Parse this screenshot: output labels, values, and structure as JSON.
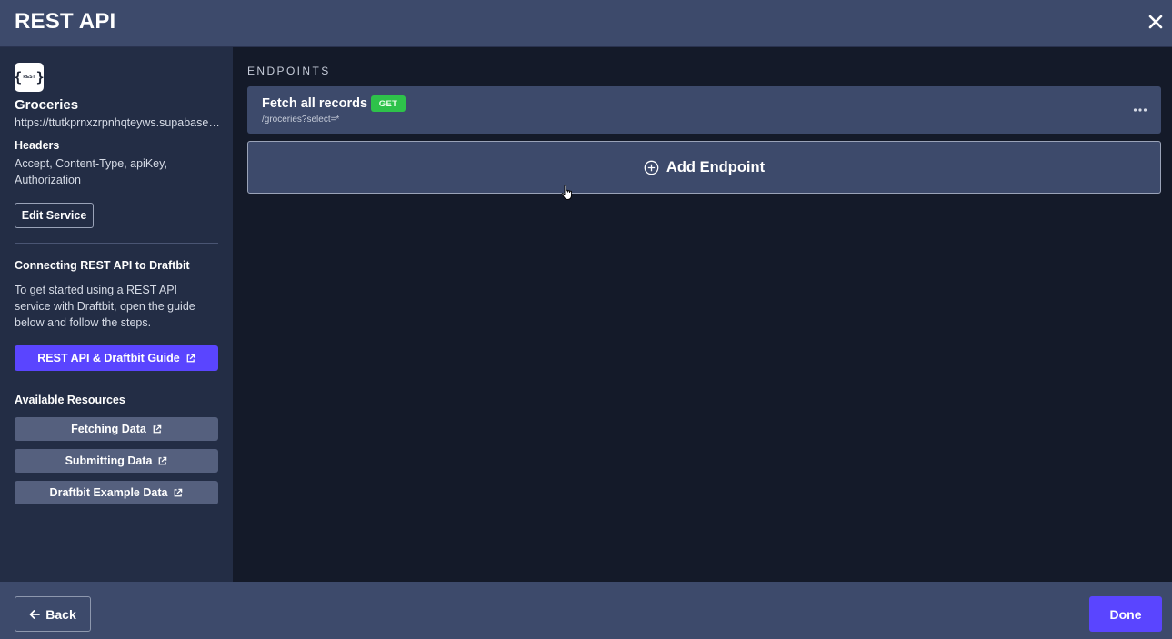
{
  "header": {
    "title": "REST API"
  },
  "sidebar": {
    "service_name": "Groceries",
    "service_url": "https://ttutkprnxzrpnhqteyws.supabase.co/rest/v1",
    "logo_text": "REST",
    "headers_title": "Headers",
    "headers_list": "Accept, Content-Type, apiKey, Authorization",
    "edit_label": "Edit Service",
    "connect_title": "Connecting REST API to Draftbit",
    "connect_body": "To get started using a REST API service with Draftbit, open the guide below and follow the steps.",
    "guide_label": "REST API & Draftbit Guide",
    "resources_title": "Available Resources",
    "resources": [
      {
        "label": "Fetching Data"
      },
      {
        "label": "Submitting Data"
      },
      {
        "label": "Draftbit Example Data"
      }
    ]
  },
  "main": {
    "section_label": "ENDPOINTS",
    "endpoints": [
      {
        "name": "Fetch all records",
        "method": "GET",
        "path": "/groceries?select=*"
      }
    ],
    "add_label": "Add Endpoint"
  },
  "footer": {
    "back_label": "Back",
    "done_label": "Done"
  },
  "colors": {
    "accent": "#5a45ff",
    "get_badge": "#2ec24a",
    "panel": "#3d4a6b",
    "sidebar": "#232d45",
    "background": "#141a29"
  }
}
